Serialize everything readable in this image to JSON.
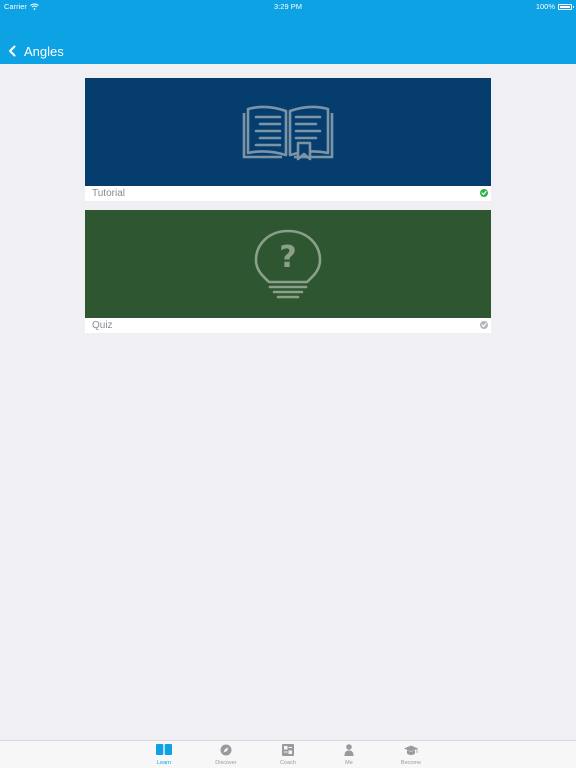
{
  "status_bar": {
    "carrier": "Carrier",
    "time": "3:29 PM",
    "battery": "100%"
  },
  "header": {
    "title": "Angles"
  },
  "cards": [
    {
      "label": "Tutorial",
      "color": "#053e6e",
      "icon": "open-book-icon",
      "completed": true
    },
    {
      "label": "Quiz",
      "color": "#2e5630",
      "icon": "lightbulb-question-icon",
      "completed": false
    }
  ],
  "tabs": [
    {
      "label": "Learn",
      "icon": "book-icon",
      "active": true
    },
    {
      "label": "Discover",
      "icon": "compass-icon"
    },
    {
      "label": "Coach",
      "icon": "coach-icon"
    },
    {
      "label": "Me",
      "icon": "person-icon"
    },
    {
      "label": "Become",
      "icon": "graduation-cap-icon"
    }
  ],
  "colors": {
    "accent": "#0ca2e4",
    "check_done": "#2fb34a",
    "check_pending": "#b5b5b9"
  }
}
